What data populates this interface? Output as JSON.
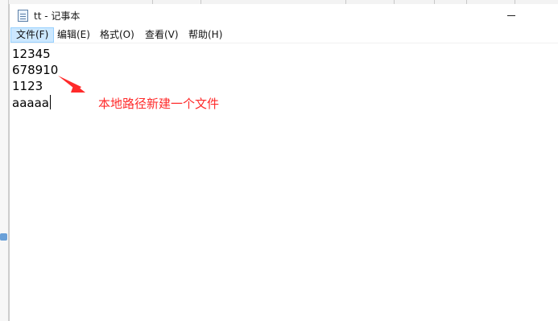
{
  "window": {
    "title": "tt - 记事本"
  },
  "menu": {
    "items": [
      "文件(F)",
      "编辑(E)",
      "格式(O)",
      "查看(V)",
      "帮助(H)"
    ],
    "active_index": 0
  },
  "editor": {
    "lines": [
      "12345",
      "678910",
      "1123",
      "aaaaa"
    ]
  },
  "annotation": {
    "text": "本地路径新建一个文件",
    "color": "#ff2a2a"
  },
  "icons": {
    "app": "notepad-icon",
    "minimize": "minimize-icon",
    "arrow": "red-arrow-icon"
  },
  "colors": {
    "menu_highlight": "#cce8ff",
    "menu_highlight_border": "#99d1ff"
  }
}
